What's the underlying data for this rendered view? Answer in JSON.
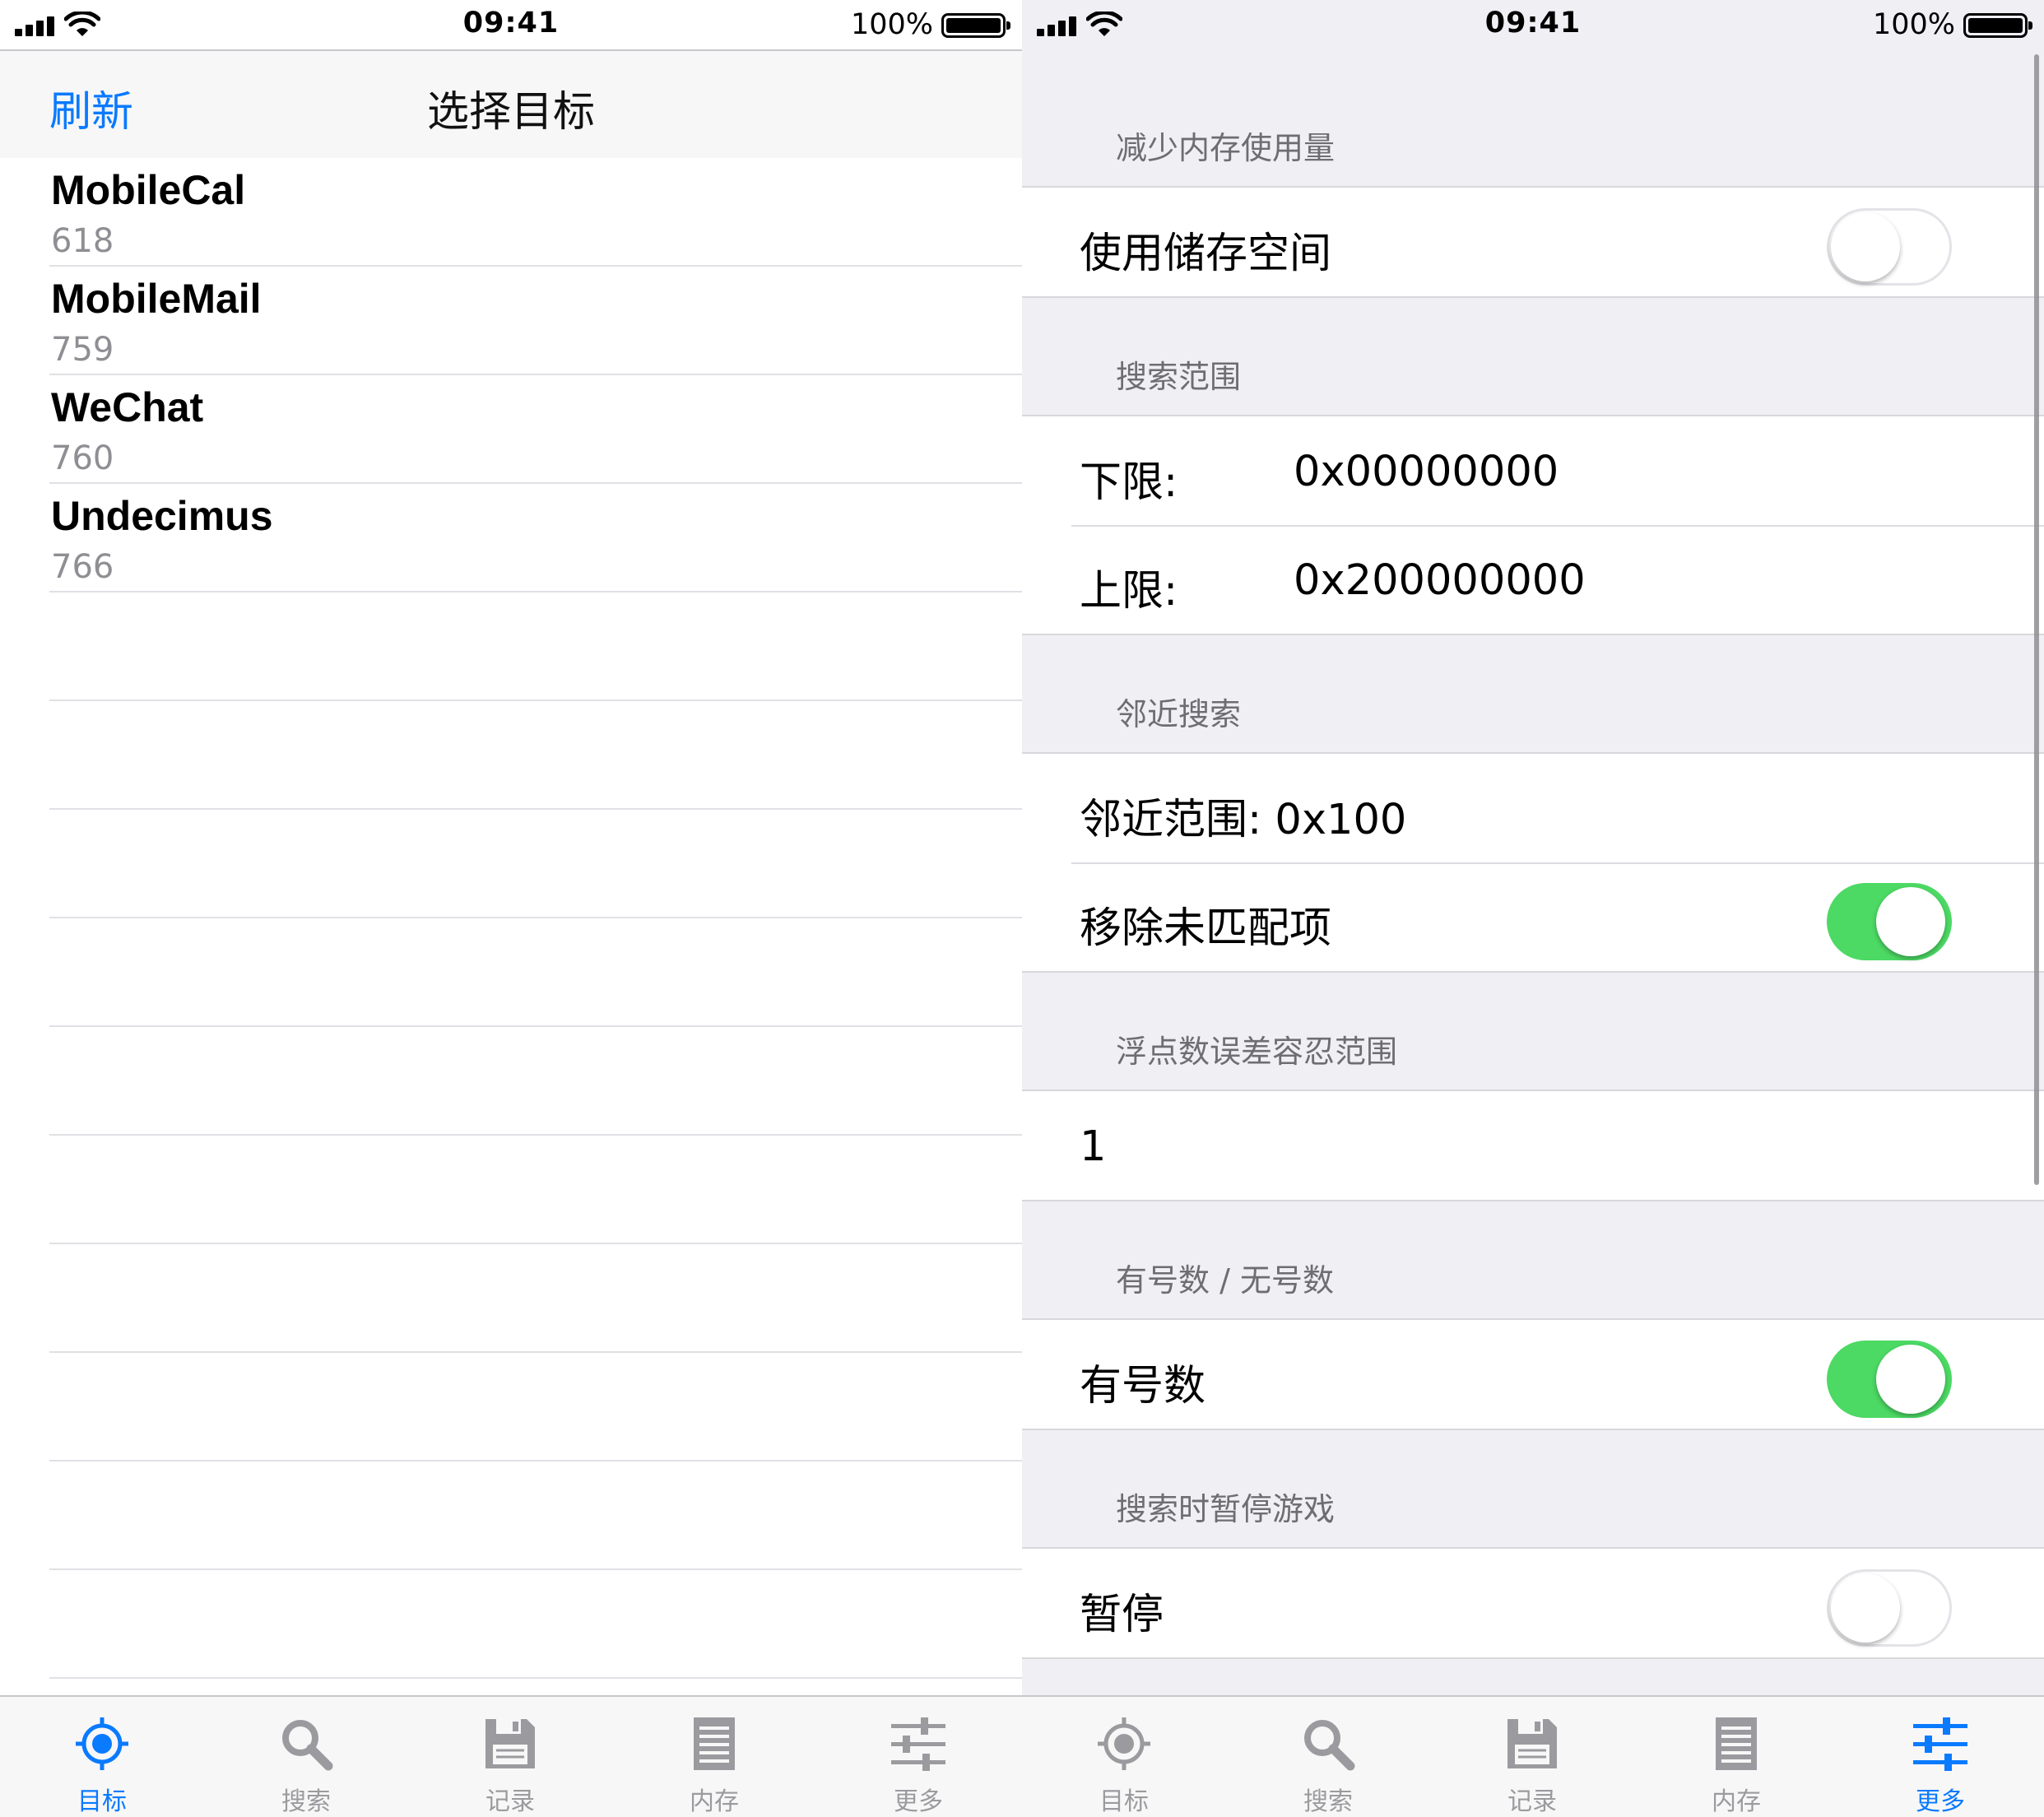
{
  "status_bar": {
    "time": "09:41",
    "battery_percent": "100%"
  },
  "left_screen": {
    "nav": {
      "refresh_label": "刷新",
      "title": "选择目标"
    },
    "processes": [
      {
        "name": "MobileCal",
        "pid": "618"
      },
      {
        "name": "MobileMail",
        "pid": "759"
      },
      {
        "name": "WeChat",
        "pid": "760"
      },
      {
        "name": "Undecimus",
        "pid": "766"
      }
    ]
  },
  "right_screen": {
    "sections": {
      "reduce_memory": {
        "header": "减少内存使用量",
        "use_storage": {
          "label": "使用储存空间",
          "on": false
        }
      },
      "search_range": {
        "header": "搜索范围",
        "lower": {
          "label": "下限:",
          "value": "0x00000000"
        },
        "upper": {
          "label": "上限:",
          "value": "0x200000000"
        }
      },
      "nearby_search": {
        "header": "邻近搜索",
        "range_text": "邻近范围: 0x100",
        "remove_unmatched": {
          "label": "移除未匹配项",
          "on": true
        }
      },
      "float_tolerance": {
        "header": "浮点数误差容忍范围",
        "value": "1"
      },
      "signedness": {
        "header": "有号数 / 无号数",
        "signed": {
          "label": "有号数",
          "on": true
        }
      },
      "pause_game": {
        "header": "搜索时暂停游戏",
        "pause": {
          "label": "暂停",
          "on": false
        }
      }
    }
  },
  "tab_bar": {
    "items": [
      {
        "label": "目标",
        "icon": "target-icon"
      },
      {
        "label": "搜索",
        "icon": "search-icon"
      },
      {
        "label": "记录",
        "icon": "save-icon"
      },
      {
        "label": "内存",
        "icon": "memory-icon"
      },
      {
        "label": "更多",
        "icon": "sliders-icon"
      }
    ],
    "left_active": "目标",
    "right_active": "更多"
  },
  "colors": {
    "accent": "#0a7aff",
    "toggle_on": "#4cd964",
    "tab_inactive": "#9b9b9f",
    "grouped_background": "#efeff4",
    "secondary_text": "#8e8e93"
  }
}
